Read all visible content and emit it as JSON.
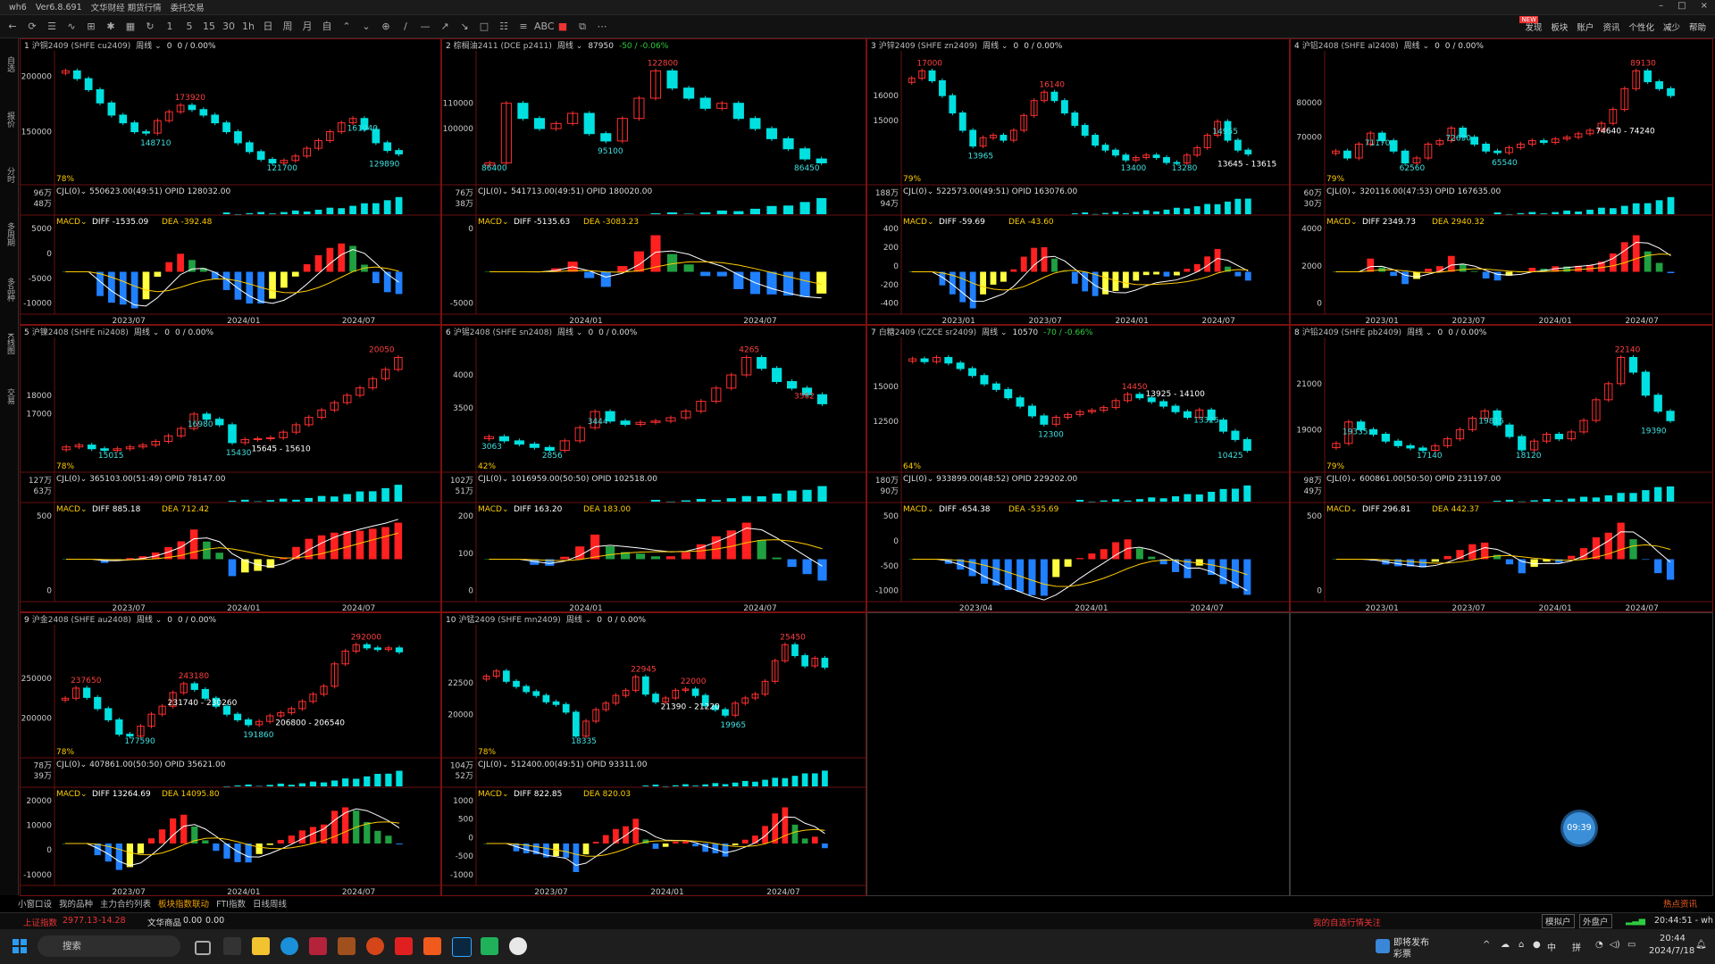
{
  "titlebar": {
    "items": [
      "wh6",
      "Ver6.8.691",
      "文华财经 期货行情",
      "委托交易"
    ]
  },
  "toolbar": {
    "icons": [
      "back-icon",
      "refresh-icon",
      "list-icon",
      "line-chart-icon",
      "candle-icon",
      "indicator-icon",
      "layout-icon",
      "sync-icon",
      "period-1m-icon",
      "period-5m-icon",
      "period-15m-icon",
      "period-30m-icon",
      "period-1h-icon",
      "period-day-icon",
      "period-week-icon",
      "period-month-icon",
      "custom-period-icon",
      "up-icon",
      "down-icon",
      "cursor-icon",
      "draw-line-icon",
      "draw-hline-icon",
      "draw-ray-icon",
      "draw-arrow-icon",
      "draw-rect-icon",
      "draw-text-icon",
      "fib-icon",
      "text-tool-icon",
      "red-square-icon",
      "copy-icon",
      "more-icon"
    ],
    "icon_glyphs": [
      "←",
      "⟳",
      "☰",
      "∿",
      "⊞",
      "✱",
      "▦",
      "↻",
      "1",
      "5",
      "15",
      "30",
      "1h",
      "日",
      "周",
      "月",
      "自",
      "⌃",
      "⌄",
      "⊕",
      "/",
      "—",
      "↗",
      "↘",
      "□",
      "☷",
      "≡",
      "ABC",
      "■",
      "⧉",
      "⋯"
    ],
    "right_items": [
      "发现",
      "板块",
      "账户",
      "资讯",
      "个性化",
      "减少",
      "帮助"
    ],
    "new_badge": "NEW"
  },
  "sidebar": {
    "items": [
      "自选",
      "报价",
      "分时",
      "多周期",
      "多品种",
      "K线图",
      "交易"
    ]
  },
  "panels": [
    {
      "num": "1",
      "inst": "沪铜2409 (SHFE cu2409)",
      "period": "周线",
      "price": "0",
      "chg": "0 / 0.00%",
      "chart_data": {
        "type": "candlestick",
        "price_ticks": [
          "200000",
          "150000"
        ],
        "labels": [
          "173920",
          "161940",
          "148710",
          "121700",
          "129890"
        ],
        "ratio": "78%",
        "volume": {
          "label": "CJL(0)",
          "value": "550623.00(49:51)",
          "opid": "OPID 128032.00",
          "ticks": [
            "96万",
            "48万"
          ]
        },
        "macd": {
          "label": "MACD",
          "diff": "DIFF -1535.09",
          "dea": "DEA -392.48",
          "ticks": [
            "5000",
            "0",
            "-5000",
            "-10000"
          ]
        },
        "x_ticks": [
          "2023/07",
          "2024/01",
          "2024/07"
        ],
        "close": [
          205000,
          198000,
          188000,
          176000,
          165000,
          158000,
          150000,
          148710,
          160000,
          168000,
          173920,
          170000,
          165000,
          158000,
          150000,
          140000,
          132000,
          125000,
          121700,
          124000,
          128000,
          135000,
          142000,
          150000,
          158000,
          161940,
          152000,
          140000,
          133000,
          129890
        ]
      }
    },
    {
      "num": "2",
      "inst": "棕榈油2411 (DCE p2411)",
      "period": "周线",
      "price": "87950",
      "chg": "-50 / -0.06%",
      "chart_data": {
        "type": "candlestick",
        "price_ticks": [
          "110000",
          "100000"
        ],
        "labels": [
          "122800",
          "95100",
          "86450",
          "86400"
        ],
        "ratio": "",
        "volume": {
          "label": "CJL(0)",
          "value": "541713.00(49:51)",
          "opid": "OPID 180020.00",
          "ticks": [
            "76万",
            "38万"
          ]
        },
        "macd": {
          "label": "MACD",
          "diff": "DIFF -5135.63",
          "dea": "DEA -3083.23",
          "ticks": [
            "0",
            "-5000"
          ]
        },
        "x_ticks": [
          "2024/01",
          "2024/07"
        ],
        "close": [
          86400,
          110000,
          104000,
          100000,
          102000,
          106000,
          98000,
          95100,
          104000,
          112000,
          122800,
          116000,
          112000,
          108000,
          110000,
          104000,
          100000,
          96000,
          92000,
          88000,
          86450
        ]
      }
    },
    {
      "num": "3",
      "inst": "沪锌2409 (SHFE zn2409)",
      "period": "周线",
      "price": "0",
      "chg": "0 / 0.00%",
      "chart_data": {
        "type": "candlestick",
        "price_ticks": [
          "16000",
          "15000"
        ],
        "labels": [
          "17000",
          "16140",
          "14955",
          "13965",
          "13400",
          "13645 - 13615",
          "13280"
        ],
        "ratio": "79%",
        "volume": {
          "label": "CJL(0)",
          "value": "522573.00(49:51)",
          "opid": "OPID 163076.00",
          "ticks": [
            "188万",
            "94万"
          ]
        },
        "macd": {
          "label": "MACD",
          "diff": "DIFF -59.69",
          "dea": "DEA -43.60",
          "ticks": [
            "400",
            "200",
            "0",
            "-200",
            "-400"
          ]
        },
        "x_ticks": [
          "2023/01",
          "2023/07",
          "2024/01",
          "2024/07"
        ],
        "close": [
          16700,
          17000,
          16600,
          16000,
          15300,
          14600,
          13965,
          14300,
          14400,
          14200,
          14600,
          15200,
          15800,
          16140,
          15800,
          15300,
          14800,
          14400,
          14000,
          13800,
          13600,
          13400,
          13500,
          13600,
          13500,
          13300,
          13280,
          13600,
          13900,
          14400,
          14955,
          14200,
          13800,
          13645
        ]
      }
    },
    {
      "num": "4",
      "inst": "沪铝2408 (SHFE al2408)",
      "period": "周线",
      "price": "0",
      "chg": "0 / 0.00%",
      "chart_data": {
        "type": "candlestick",
        "price_ticks": [
          "80000",
          "70000"
        ],
        "labels": [
          "89130",
          "71170",
          "72630",
          "62560",
          "65540",
          "74640 - 74240"
        ],
        "ratio": "79%",
        "volume": {
          "label": "CJL(0)",
          "value": "320116.00(47:53)",
          "opid": "OPID 167635.00",
          "ticks": [
            "60万",
            "30万"
          ]
        },
        "macd": {
          "label": "MACD",
          "diff": "DIFF 2349.73",
          "dea": "DEA 2940.32",
          "ticks": [
            "4000",
            "2000",
            "0"
          ]
        },
        "x_ticks": [
          "2023/01",
          "2023/07",
          "2024/01",
          "2024/07"
        ],
        "close": [
          66000,
          64000,
          68000,
          71170,
          69000,
          66000,
          62560,
          64000,
          68000,
          69000,
          72630,
          70000,
          68000,
          66000,
          65540,
          67000,
          68000,
          69000,
          68500,
          69500,
          70000,
          71000,
          72000,
          74000,
          78000,
          84000,
          89130,
          86000,
          84000,
          82000
        ]
      }
    },
    {
      "num": "5",
      "inst": "沪镍2408 (SHFE ni2408)",
      "period": "周线",
      "price": "0",
      "chg": "0 / 0.00%",
      "chart_data": {
        "type": "candlestick",
        "price_ticks": [
          "18000",
          "17000"
        ],
        "labels": [
          "20050",
          "16980",
          "15430",
          "15015",
          "15645 - 15610"
        ],
        "ratio": "78%",
        "volume": {
          "label": "CJL(0)",
          "value": "365103.00(51:49)",
          "opid": "OPID 78147.00",
          "ticks": [
            "127万",
            "63万"
          ]
        },
        "macd": {
          "label": "MACD",
          "diff": "DIFF 885.18",
          "dea": "DEA 712.42",
          "ticks": [
            "500",
            "0"
          ]
        },
        "x_ticks": [
          "2023/07",
          "2024/01",
          "2024/07"
        ],
        "close": [
          15200,
          15300,
          15100,
          15015,
          15100,
          15200,
          15300,
          15500,
          15800,
          16200,
          16980,
          16700,
          16400,
          15430,
          15600,
          15645,
          15700,
          16000,
          16400,
          16800,
          17200,
          17600,
          18000,
          18400,
          18900,
          19400,
          20050
        ]
      }
    },
    {
      "num": "6",
      "inst": "沪锡2408 (SHFE sn2408)",
      "period": "周线",
      "price": "0",
      "chg": "0 / 0.00%",
      "chart_data": {
        "type": "candlestick",
        "price_ticks": [
          "4000",
          "3500"
        ],
        "labels": [
          "4265",
          "3444",
          "3063",
          "3562",
          "2856"
        ],
        "ratio": "42%",
        "volume": {
          "label": "CJL(0)",
          "value": "1016959.00(50:50)",
          "opid": "OPID 102518.00",
          "ticks": [
            "102万",
            "51万"
          ]
        },
        "macd": {
          "label": "MACD",
          "diff": "DIFF 163.20",
          "dea": "DEA 183.00",
          "ticks": [
            "200",
            "100",
            "0"
          ]
        },
        "x_ticks": [
          "2024/01",
          "2024/07"
        ],
        "close": [
          3063,
          3000,
          2950,
          2900,
          2856,
          3000,
          3200,
          3444,
          3300,
          3250,
          3280,
          3300,
          3350,
          3450,
          3600,
          3800,
          4000,
          4265,
          4100,
          3900,
          3800,
          3700,
          3562
        ]
      }
    },
    {
      "num": "7",
      "inst": "白糖2409 (CZCE sr2409)",
      "period": "周线",
      "price": "10570",
      "chg": "-70 / -0.66%",
      "chart_data": {
        "type": "candlestick",
        "price_ticks": [
          "15000",
          "12500"
        ],
        "labels": [
          "14450",
          "13925 - 14100",
          "13325",
          "12300",
          "10425"
        ],
        "ratio": "64%",
        "volume": {
          "label": "CJL(0)",
          "value": "933899.00(48:52)",
          "opid": "OPID 229202.00",
          "ticks": [
            "180万",
            "90万"
          ]
        },
        "macd": {
          "label": "MACD",
          "diff": "DIFF -654.38",
          "dea": "DEA -535.69",
          "ticks": [
            "500",
            "0",
            "-500",
            "-1000"
          ]
        },
        "x_ticks": [
          "2023/04",
          "2024/01",
          "2024/07"
        ],
        "close": [
          17000,
          16800,
          17100,
          16700,
          16300,
          15800,
          15200,
          14800,
          14200,
          13600,
          12900,
          12300,
          12800,
          13000,
          13200,
          13300,
          13500,
          14000,
          14450,
          14200,
          13925,
          13600,
          13200,
          12800,
          13325,
          12600,
          11800,
          11200,
          10425
        ]
      }
    },
    {
      "num": "8",
      "inst": "沪铅2409 (SHFE pb2409)",
      "period": "周线",
      "price": "0",
      "chg": "0 / 0.00%",
      "chart_data": {
        "type": "candlestick",
        "price_ticks": [
          "21000",
          "19000"
        ],
        "labels": [
          "22140",
          "19335",
          "19815",
          "18120",
          "17140",
          "19390"
        ],
        "ratio": "79%",
        "volume": {
          "label": "CJL(0)",
          "value": "600861.00(50:50)",
          "opid": "OPID 231197.00",
          "ticks": [
            "98万",
            "49万"
          ]
        },
        "macd": {
          "label": "MACD",
          "diff": "DIFF 296.81",
          "dea": "DEA 442.37",
          "ticks": [
            "500",
            "0"
          ]
        },
        "x_ticks": [
          "2023/01",
          "2023/07",
          "2024/01",
          "2024/07"
        ],
        "close": [
          18400,
          19335,
          19000,
          18800,
          18500,
          18300,
          18200,
          18100,
          18300,
          18600,
          19000,
          19500,
          19815,
          19200,
          18700,
          18120,
          18500,
          18800,
          18600,
          18900,
          19400,
          20300,
          21000,
          22140,
          21500,
          20500,
          19800,
          19390
        ]
      }
    },
    {
      "num": "9",
      "inst": "沪金2408 (SHFE au2408)",
      "period": "周线",
      "price": "0",
      "chg": "0 / 0.00%",
      "chart_data": {
        "type": "candlestick",
        "price_ticks": [
          "250000",
          "200000"
        ],
        "labels": [
          "292000",
          "237650",
          "243180",
          "231740 - 230260",
          "206800 - 206540",
          "191860",
          "177590"
        ],
        "ratio": "78%",
        "volume": {
          "label": "CJL(0)",
          "value": "407861.00(50:50)",
          "opid": "OPID 35621.00",
          "ticks": [
            "78万",
            "39万"
          ]
        },
        "macd": {
          "label": "MACD",
          "diff": "DIFF 13264.69",
          "dea": "DEA 14095.80",
          "ticks": [
            "20000",
            "10000",
            "0",
            "-10000"
          ]
        },
        "x_ticks": [
          "2023/07",
          "2024/01",
          "2024/07"
        ],
        "close": [
          225000,
          237650,
          226000,
          212000,
          198000,
          180000,
          177590,
          190000,
          205000,
          215000,
          232000,
          243180,
          236000,
          225000,
          215000,
          205000,
          198000,
          191860,
          196000,
          203000,
          206800,
          212000,
          221000,
          230000,
          240000,
          268000,
          284000,
          292000,
          288000,
          286000,
          288000,
          283000
        ]
      }
    },
    {
      "num": "10",
      "inst": "沪锰2409 (SHFE mn2409)",
      "period": "周线",
      "price": "0",
      "chg": "0 / 0.00%",
      "chart_data": {
        "type": "candlestick",
        "price_ticks": [
          "22500",
          "20000"
        ],
        "labels": [
          "25450",
          "22945",
          "22000",
          "18335",
          "19965",
          "21390 - 21220"
        ],
        "ratio": "78%",
        "volume": {
          "label": "CJL(0)",
          "value": "512400.00(49:51)",
          "opid": "OPID 93311.00",
          "ticks": [
            "104万",
            "52万"
          ]
        },
        "macd": {
          "label": "MACD",
          "diff": "DIFF 822.85",
          "dea": "DEA 820.03",
          "ticks": [
            "1000",
            "500",
            "0",
            "-500",
            "-1000"
          ]
        },
        "x_ticks": [
          "2023/07",
          "2024/01",
          "2024/07"
        ],
        "close": [
          23000,
          23400,
          22600,
          22200,
          21800,
          21500,
          21000,
          20800,
          20200,
          18335,
          19500,
          20400,
          20900,
          21500,
          21900,
          22945,
          21600,
          21000,
          21300,
          21900,
          22000,
          21500,
          20700,
          20400,
          19965,
          20900,
          21300,
          21600,
          22600,
          24200,
          25450,
          24600,
          23800,
          24400,
          23700
        ]
      }
    }
  ],
  "bottom_tabs": [
    "小窗口设",
    "我的品种",
    "主力合约列表",
    "板块指数联动",
    "FTI指数",
    "日线周线"
  ],
  "bottom_active": "板块指数联动",
  "hotspot": "热点资讯",
  "status": {
    "index_name": "上证指数",
    "index_val": "2977.13",
    "index_chg": "-14.28",
    "product": "文华商品",
    "product_val": "0.00",
    "product_chg": "0.00",
    "scroll_news": "我的自选行情关注",
    "account_items": [
      "模拟户",
      "外盘户"
    ],
    "time": "20:44:51 - wh"
  },
  "timer": "09:39",
  "taskbar": {
    "search": "搜索",
    "weather_title": "即将发布",
    "weather_sub": "彩票",
    "time": "20:44",
    "date": "2024/7/18",
    "ime_items": [
      "中",
      "拼"
    ]
  }
}
